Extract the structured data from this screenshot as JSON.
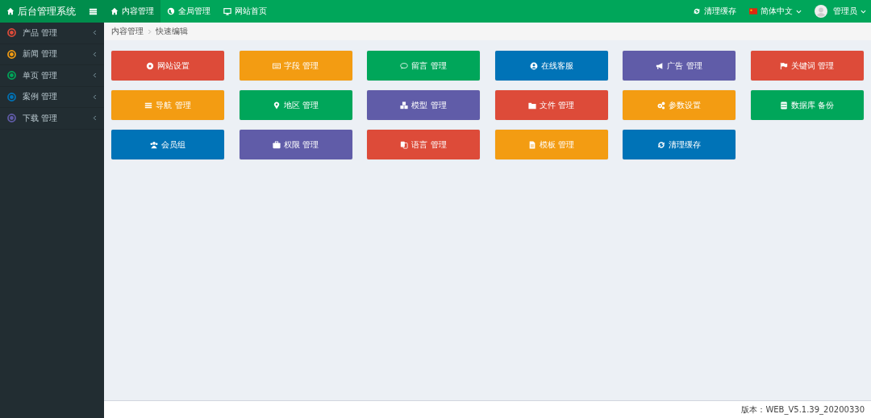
{
  "logo": {
    "title": "后台管理系统"
  },
  "top_nav": [
    {
      "label": "内容管理",
      "selected": true
    },
    {
      "label": "全局管理",
      "selected": false
    },
    {
      "label": "网站首页",
      "selected": false
    }
  ],
  "top_right": {
    "clear_cache": "清理缓存",
    "language": "简体中文",
    "user": "管理员"
  },
  "sidebar": {
    "items": [
      {
        "label": "产品 管理",
        "color": "#dd4b39"
      },
      {
        "label": "新闻 管理",
        "color": "#f39c12"
      },
      {
        "label": "单页 管理",
        "color": "#00a65a"
      },
      {
        "label": "案例 管理",
        "color": "#0073b7"
      },
      {
        "label": "下载 管理",
        "color": "#605ca8"
      }
    ]
  },
  "breadcrumb": [
    "内容管理",
    "快速编辑"
  ],
  "tiles": [
    {
      "label": "网站设置",
      "color": "#dd4b39"
    },
    {
      "label": "字段 管理",
      "color": "#f39c12"
    },
    {
      "label": "留言 管理",
      "color": "#00a65a"
    },
    {
      "label": "在线客服",
      "color": "#0073b7"
    },
    {
      "label": "广告 管理",
      "color": "#605ca8"
    },
    {
      "label": "关键词 管理",
      "color": "#dd4b39"
    },
    {
      "label": "导航 管理",
      "color": "#f39c12"
    },
    {
      "label": "地区 管理",
      "color": "#00a65a"
    },
    {
      "label": "模型 管理",
      "color": "#605ca8"
    },
    {
      "label": "文件 管理",
      "color": "#dd4b39"
    },
    {
      "label": "参数设置",
      "color": "#f39c12"
    },
    {
      "label": "数据库 备份",
      "color": "#00a65a"
    },
    {
      "label": "会员组",
      "color": "#0073b7"
    },
    {
      "label": "权限 管理",
      "color": "#605ca8"
    },
    {
      "label": "语言 管理",
      "color": "#dd4b39"
    },
    {
      "label": "模板 管理",
      "color": "#f39c12"
    },
    {
      "label": "清理缓存",
      "color": "#0073b7"
    }
  ],
  "footer": {
    "version": "版本：WEB_V5.1.39_20200330"
  }
}
